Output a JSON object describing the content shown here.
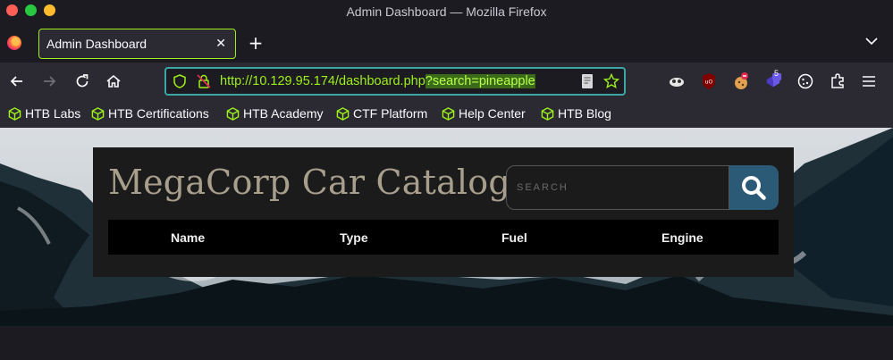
{
  "window": {
    "title": "Admin Dashboard — Mozilla Firefox"
  },
  "tabs": [
    {
      "label": "Admin Dashboard",
      "close": "✕"
    }
  ],
  "new_tab": "+",
  "url": {
    "base": "http://10.129.95.174/dashboard.php",
    "query": "?search=pineapple"
  },
  "extensions": {
    "badge_count": "5"
  },
  "bookmarks": [
    {
      "label": "HTB Labs"
    },
    {
      "label": "HTB Certifications"
    },
    {
      "label": "HTB Academy"
    },
    {
      "label": "CTF Platform"
    },
    {
      "label": "Help Center"
    },
    {
      "label": "HTB Blog"
    }
  ],
  "page": {
    "title": "MegaCorp Car Catalogue",
    "search_placeholder": "SEARCH",
    "columns": [
      "Name",
      "Type",
      "Fuel",
      "Engine"
    ]
  },
  "colors": {
    "accent": "#9ef01a",
    "panel": "#1b1b1b",
    "title": "#a79e8c",
    "search_button": "#2b5a77"
  }
}
